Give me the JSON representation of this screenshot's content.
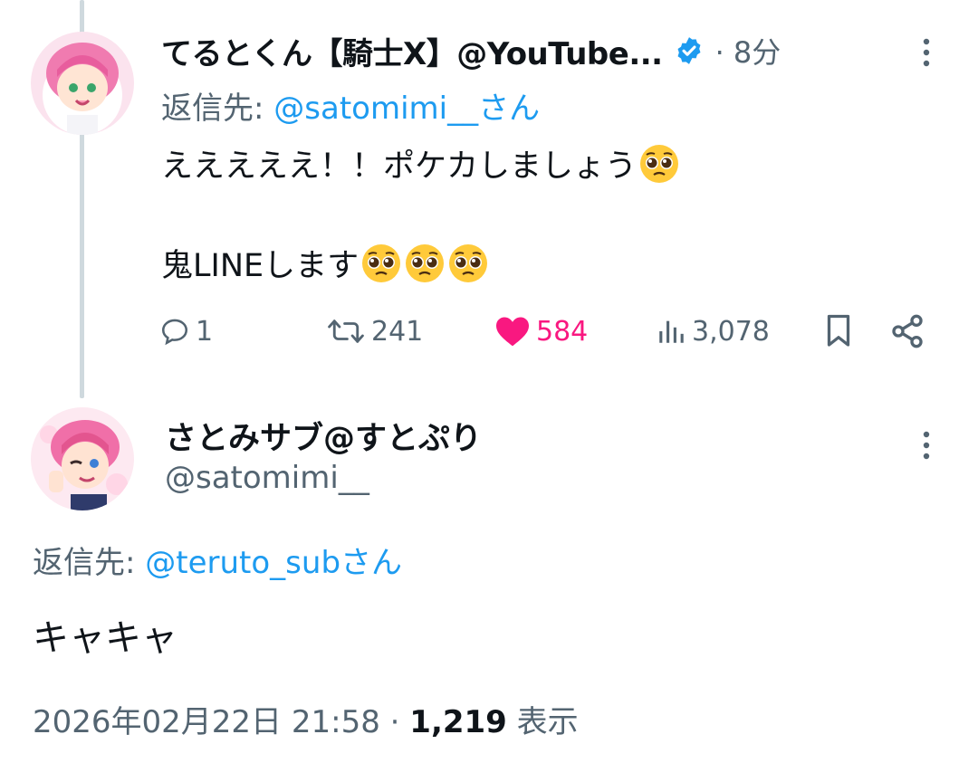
{
  "tweet1": {
    "display_name": "てるとくん【騎士X】@YouTube...",
    "time": "· 8分",
    "reply_prefix": "返信先: ",
    "reply_handle": "@satomimi__さん",
    "body_line1": "えええええ！！ポケカしましょう",
    "body_line2": "鬼LINEします",
    "counts": {
      "replies": "1",
      "retweets": "241",
      "likes": "584",
      "views": "3,078"
    }
  },
  "tweet2": {
    "display_name": "さとみサブ@すとぷり",
    "handle": "@satomimi__",
    "reply_prefix": "返信先: ",
    "reply_handle": "@teruto_subさん",
    "body": "キャキャ",
    "timestamp": "2026年02月22日 21:58 · ",
    "views_count": "1,219",
    "views_label": " 表示"
  },
  "icons": {
    "verified": "verified-badge-icon",
    "more": "more-vertical-icon",
    "reply": "reply-icon",
    "retweet": "retweet-icon",
    "like": "heart-icon",
    "views": "views-icon",
    "bookmark": "bookmark-icon",
    "share": "share-icon",
    "emoji": "pleading-face-emoji"
  },
  "colors": {
    "link": "#1d9bf0",
    "muted": "#536471",
    "like": "#f91880",
    "thread_line": "#cfd9de",
    "text": "#0f1419"
  }
}
